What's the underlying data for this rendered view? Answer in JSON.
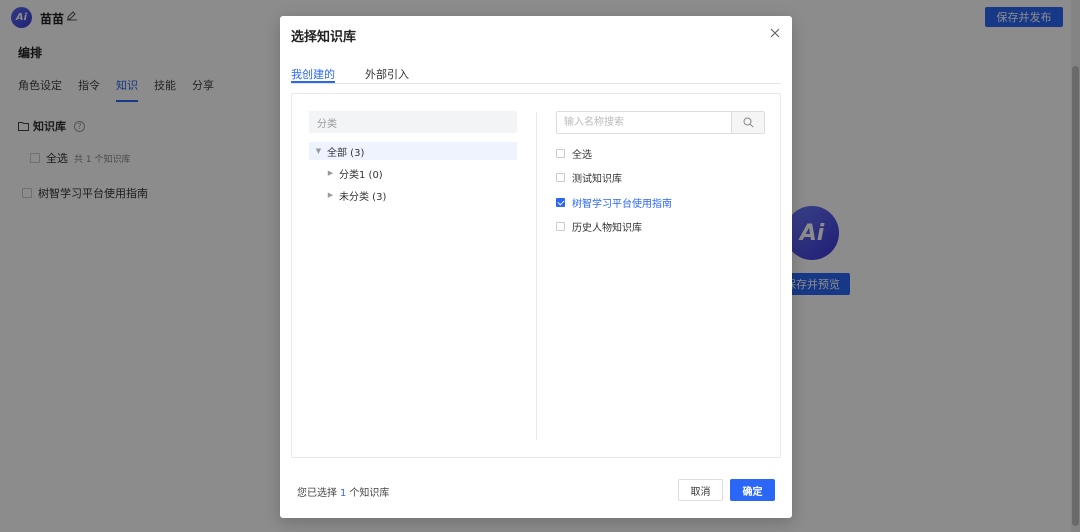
{
  "header": {
    "logo_text": "Ai",
    "app_name": "苗苗",
    "publish_label": "保存并发布"
  },
  "sidebar": {
    "section_title": "编排",
    "tabs": [
      {
        "label": "角色设定"
      },
      {
        "label": "指令"
      },
      {
        "label": "知识"
      },
      {
        "label": "技能"
      },
      {
        "label": "分享"
      }
    ],
    "active_tab": "知识",
    "kb_title": "知识库",
    "select_all_label": "全选",
    "select_all_count": "共 1 个知识库",
    "items": [
      {
        "label": "树智学习平台使用指南"
      }
    ]
  },
  "preview": {
    "avatar_text": "Ai",
    "button_label": "保存并预览"
  },
  "modal": {
    "title": "选择知识库",
    "tabs": [
      {
        "label": "我创建的",
        "active": true
      },
      {
        "label": "外部引入",
        "active": false
      }
    ],
    "category_header": "分类",
    "tree": [
      {
        "label": "全部 (3)",
        "expanded": true,
        "selected": true
      },
      {
        "label": "分类1 (0)",
        "expanded": false,
        "selected": false
      },
      {
        "label": "未分类 (3)",
        "expanded": false,
        "selected": false
      }
    ],
    "search_placeholder": "输入名称搜索",
    "options": [
      {
        "label": "全选",
        "checked": false
      },
      {
        "label": "测试知识库",
        "checked": false
      },
      {
        "label": "树智学习平台使用指南",
        "checked": true
      },
      {
        "label": "历史人物知识库",
        "checked": false
      }
    ],
    "footer": {
      "prefix": "您已选择",
      "count": "1",
      "suffix": "个知识库"
    },
    "cancel_label": "取消",
    "confirm_label": "确定"
  },
  "colors": {
    "accent": "#2b67f6",
    "overlay": "rgba(0,0,0,0.45)"
  }
}
